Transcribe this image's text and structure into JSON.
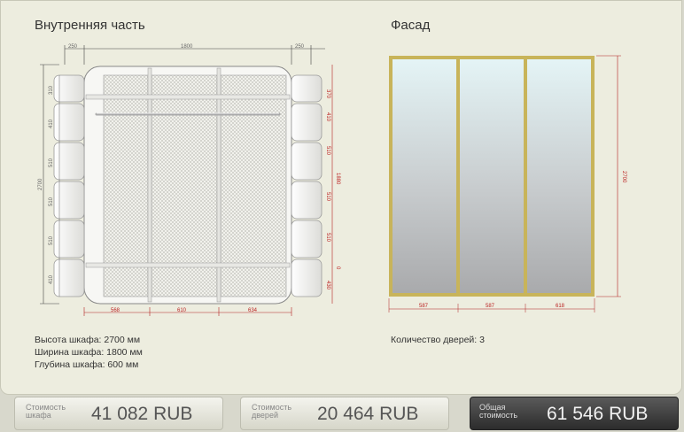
{
  "interior": {
    "title": "Внутренняя часть",
    "specs": [
      "Высота шкафа: 2700 мм",
      "Ширина шкафа: 1800 мм",
      "Глубина шкафа: 600 мм"
    ],
    "dims": {
      "top": [
        "250",
        "1800",
        "250"
      ],
      "bottom": [
        "568",
        "610",
        "634"
      ],
      "left_total": "2700",
      "left": [
        "310",
        "410",
        "510",
        "510",
        "510",
        "410"
      ],
      "right": [
        "370",
        "410",
        "1880",
        "510",
        "510",
        "510",
        "0",
        "430"
      ]
    }
  },
  "facade": {
    "title": "Фасад",
    "doors_count": "Количество дверей: 3",
    "dims": {
      "height": "2700",
      "bottom": [
        "587",
        "587",
        "618"
      ]
    }
  },
  "totals": {
    "cabinet": {
      "label": "Стоимость шкафа",
      "value": "41 082  RUB"
    },
    "doors": {
      "label": "Стоимость дверей",
      "value": "20 464  RUB"
    },
    "total": {
      "label": "Общая стоимость",
      "value": "61 546  RUB"
    }
  },
  "colors": {
    "door_frame": "#c8b45a",
    "dim_line": "#b22222",
    "accent_dark": "#3a3a3a"
  }
}
